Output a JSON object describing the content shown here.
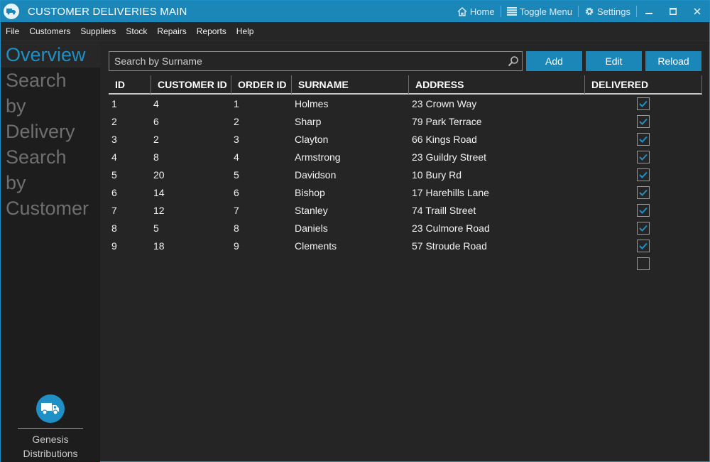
{
  "window": {
    "title": "CUSTOMER DELIVERIES MAIN",
    "commands": [
      {
        "label": "Home",
        "icon": "home-icon"
      },
      {
        "label": "Toggle Menu",
        "icon": "menu-icon"
      },
      {
        "label": "Settings",
        "icon": "gear-icon"
      }
    ],
    "controls": [
      "minimize-icon",
      "maximize-icon",
      "close-icon"
    ],
    "accent": "#1b87b8"
  },
  "menu": [
    "File",
    "Customers",
    "Suppliers",
    "Stock",
    "Repairs",
    "Reports",
    "Help"
  ],
  "sidebar": {
    "items": [
      {
        "label": "Overview",
        "active": true
      },
      {
        "label": "Search by Delivery",
        "active": false
      },
      {
        "label": "Search by Customer",
        "active": false
      }
    ],
    "brand": {
      "icon": "truck-icon",
      "name_line1": "Genesis",
      "name_line2": "Distributions"
    }
  },
  "toolbar": {
    "search_placeholder": "Search by Surname",
    "search_value": "",
    "add_label": "Add",
    "edit_label": "Edit",
    "reload_label": "Reload"
  },
  "grid": {
    "columns": [
      "ID",
      "CUSTOMER ID",
      "ORDER ID",
      "SURNAME",
      "ADDRESS",
      "DELIVERED"
    ],
    "rows": [
      {
        "id": "1",
        "customer_id": "4",
        "order_id": "1",
        "surname": "Holmes",
        "address": "23 Crown Way",
        "delivered": true
      },
      {
        "id": "2",
        "customer_id": "6",
        "order_id": "2",
        "surname": "Sharp",
        "address": "79 Park Terrace",
        "delivered": true
      },
      {
        "id": "3",
        "customer_id": "2",
        "order_id": "3",
        "surname": "Clayton",
        "address": "66 Kings Road",
        "delivered": true
      },
      {
        "id": "4",
        "customer_id": "8",
        "order_id": "4",
        "surname": "Armstrong",
        "address": "23 Guildry Street",
        "delivered": true
      },
      {
        "id": "5",
        "customer_id": "20",
        "order_id": "5",
        "surname": "Davidson",
        "address": "10 Bury Rd",
        "delivered": true
      },
      {
        "id": "6",
        "customer_id": "14",
        "order_id": "6",
        "surname": "Bishop",
        "address": "17 Harehills Lane",
        "delivered": true
      },
      {
        "id": "7",
        "customer_id": "12",
        "order_id": "7",
        "surname": "Stanley",
        "address": "74 Traill Street",
        "delivered": true
      },
      {
        "id": "8",
        "customer_id": "5",
        "order_id": "8",
        "surname": "Daniels",
        "address": "23 Culmore Road",
        "delivered": true
      },
      {
        "id": "9",
        "customer_id": "18",
        "order_id": "9",
        "surname": "Clements",
        "address": "57 Stroude Road",
        "delivered": true
      },
      {
        "id": "",
        "customer_id": "",
        "order_id": "",
        "surname": "",
        "address": "",
        "delivered": false
      }
    ]
  }
}
